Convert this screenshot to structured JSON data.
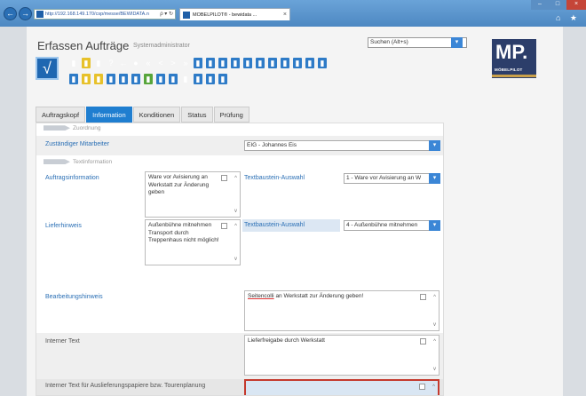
{
  "browser": {
    "address": "http://192.168.149.170/csp/messe/BEWIDATA.n",
    "address_controls": "ρ ▾ ↻",
    "tab_title": "MÖBELPILOT® - bewidata ...",
    "tab_close": "×",
    "back": "←",
    "forward": "→",
    "minimize": "–",
    "maximize": "□",
    "close": "×",
    "right_icons": "⌂ ★"
  },
  "app": {
    "title": "Erfassen Aufträge",
    "subtitle": "Systemadministrator",
    "search_placeholder": "Suchen (Alt+s)",
    "search_button": "▾",
    "logo_main": "MP.",
    "logo_sub": "MÖBELPILOT",
    "big_check": "√"
  },
  "toolbar": {
    "row1": [
      {
        "icon": "document-icon",
        "glyph": "▮",
        "color": "c-white"
      },
      {
        "icon": "document-star-icon",
        "glyph": "▮",
        "color": "c-yellow"
      },
      {
        "icon": "trash-icon",
        "glyph": "▮",
        "color": "c-white"
      },
      {
        "icon": "help-icon",
        "glyph": "?",
        "color": "c-white"
      },
      {
        "icon": "undo-icon",
        "glyph": "←",
        "color": "c-white"
      },
      {
        "icon": "search-icon",
        "glyph": "●",
        "color": "c-white"
      },
      {
        "icon": "first-icon",
        "glyph": "«",
        "color": "c-white"
      },
      {
        "icon": "prev-icon",
        "glyph": "<",
        "color": "c-white"
      },
      {
        "icon": "next-icon",
        "glyph": ">",
        "color": "c-white"
      },
      {
        "icon": "last-icon",
        "glyph": "»",
        "color": "c-white"
      },
      {
        "icon": "doc-blue-icon",
        "glyph": "▮",
        "color": "c-blue"
      },
      {
        "icon": "doc-search-icon",
        "glyph": "▮",
        "color": "c-blue"
      },
      {
        "icon": "doc-stack-icon",
        "glyph": "▮",
        "color": "c-blue"
      },
      {
        "icon": "tools-icon",
        "glyph": "▮",
        "color": "c-blue"
      },
      {
        "icon": "tools2-icon",
        "glyph": "▮",
        "color": "c-blue"
      },
      {
        "icon": "chain-icon",
        "glyph": "▮",
        "color": "c-blue"
      },
      {
        "icon": "doc-a-icon",
        "glyph": "▮",
        "color": "c-blue"
      },
      {
        "icon": "doc-b-icon",
        "glyph": "▮",
        "color": "c-blue"
      },
      {
        "icon": "doc-c-icon",
        "glyph": "▮",
        "color": "c-blue"
      },
      {
        "icon": "doc-d-icon",
        "glyph": "▮",
        "color": "c-blue"
      },
      {
        "icon": "doc-e-icon",
        "glyph": "▮",
        "color": "c-blue"
      }
    ],
    "row2": [
      {
        "icon": "doc-arrow-icon",
        "glyph": "▮",
        "color": "c-blue"
      },
      {
        "icon": "doc-yellow-icon",
        "glyph": "▮",
        "color": "c-yellow"
      },
      {
        "icon": "group-icon",
        "glyph": "▮",
        "color": "c-yellow"
      },
      {
        "icon": "doc-list-icon",
        "glyph": "▮",
        "color": "c-blue"
      },
      {
        "icon": "table-icon",
        "glyph": "▮",
        "color": "c-blue"
      },
      {
        "icon": "doc-up-icon",
        "glyph": "▮",
        "color": "c-blue"
      },
      {
        "icon": "chart-icon",
        "glyph": "▮",
        "color": "c-green"
      },
      {
        "icon": "pen-icon",
        "glyph": "▮",
        "color": "c-blue"
      },
      {
        "icon": "doc-n-icon",
        "glyph": "▮",
        "color": "c-blue"
      },
      {
        "icon": "printer-icon",
        "glyph": "▮",
        "color": "c-white"
      },
      {
        "icon": "monitor-icon",
        "glyph": "▮",
        "color": "c-blue"
      },
      {
        "icon": "doc-gear-icon",
        "glyph": "▮",
        "color": "c-blue"
      },
      {
        "icon": "image-icon",
        "glyph": "▮",
        "color": "c-blue"
      }
    ]
  },
  "tabs": [
    {
      "label": "Auftragskopf",
      "active": false
    },
    {
      "label": "Information",
      "active": true
    },
    {
      "label": "Konditionen",
      "active": false
    },
    {
      "label": "Status",
      "active": false
    },
    {
      "label": "Prüfung",
      "active": false
    }
  ],
  "sections": {
    "zuordnung": "Zuordnung",
    "textinformation": "Textinformation"
  },
  "fields": {
    "mitarbeiter_label": "Zuständiger Mitarbeiter",
    "mitarbeiter_value": "EIG - Johannes Eis",
    "auftragsinfo_label": "Auftragsinformation",
    "auftragsinfo_text": "Ware vor Avisierung an Werkstatt zur Änderung geben",
    "textbaustein1_label": "Textbaustein-Auswahl",
    "textbaustein1_value": "1 - Ware vor Avisierung an W",
    "lieferhinweis_label": "Lieferhinweis",
    "lieferhinweis_text": "Außenbühne mitnehmen Transport durch Treppenhaus nicht möglich!",
    "textbaustein2_label": "Textbaustein-Auswahl",
    "textbaustein2_value": "4 - Außenbühne mitnehmen",
    "bearbeitung_label": "Bearbeitungshinweis",
    "bearbeitung_underlined": "Seitencolli",
    "bearbeitung_text": " an Werkstatt zur Änderung geben!",
    "intern_label": "Interner Text",
    "intern_text": "Lieferfreigabe durch Werkstatt",
    "auslieferung_label": "Interner Text für Auslieferungspapiere bzw. Tourenplanung",
    "auslieferung_text": ""
  },
  "glyphs": {
    "dropdown": "▾",
    "scroll_up": "^",
    "scroll_down": "v"
  }
}
